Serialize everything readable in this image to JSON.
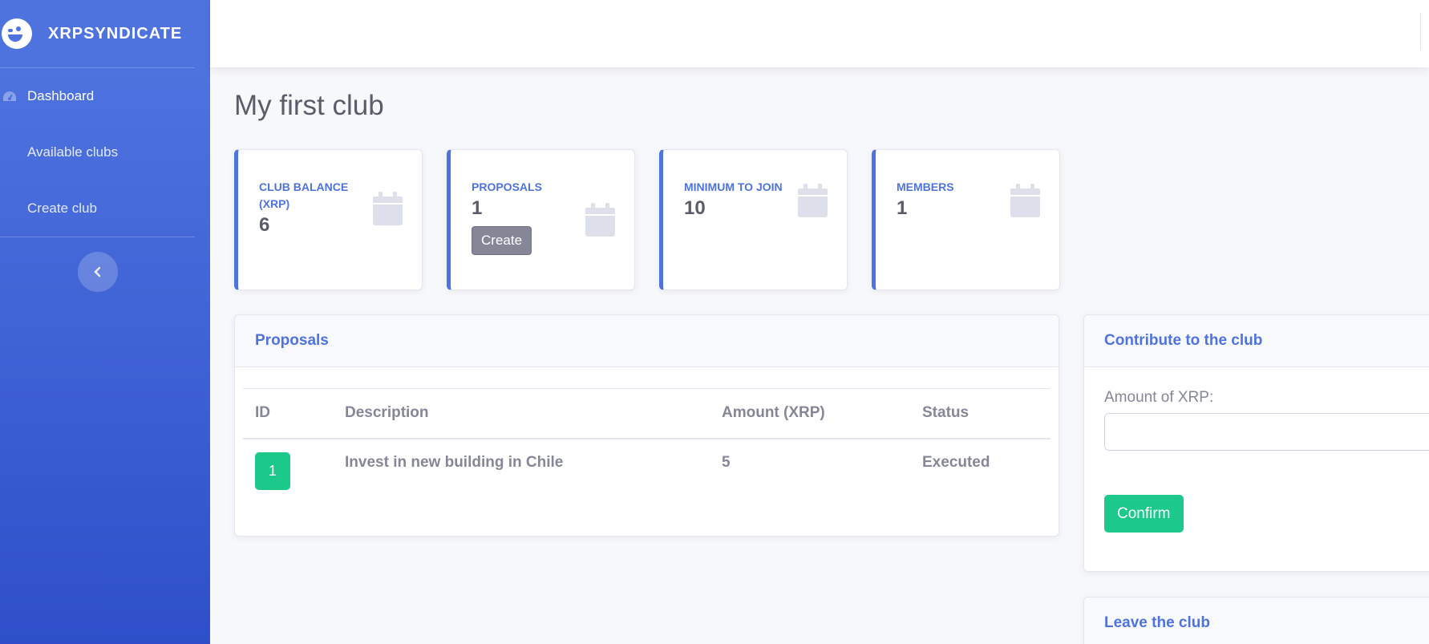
{
  "sidebar": {
    "brand": "XRPSYNDICATE",
    "items": [
      {
        "label": "Dashboard"
      },
      {
        "label": "Available clubs"
      },
      {
        "label": "Create club"
      }
    ]
  },
  "page": {
    "title": "My first club"
  },
  "stats": [
    {
      "label": "CLUB BALANCE (XRP)",
      "value": "6"
    },
    {
      "label": "PROPOSALS",
      "value": "1",
      "button": "Create"
    },
    {
      "label": "MINIMUM TO JOIN",
      "value": "10"
    },
    {
      "label": "MEMBERS",
      "value": "1"
    }
  ],
  "proposals": {
    "title": "Proposals",
    "columns": [
      "ID",
      "Description",
      "Amount (XRP)",
      "Status"
    ],
    "rows": [
      {
        "id": "1",
        "description": "Invest in new building in Chile",
        "amount": "5",
        "status": "Executed"
      }
    ]
  },
  "contribute": {
    "title": "Contribute to the club",
    "amount_label": "Amount of XRP:",
    "amount_value": "",
    "confirm_label": "Confirm"
  },
  "leave": {
    "title": "Leave the club"
  },
  "colors": {
    "primary": "#4e73df",
    "success": "#1cc88a",
    "secondary": "#858796"
  },
  "icons": {
    "stat": "calendar-icon",
    "dashboard": "tachometer-icon",
    "toggle": "chevron-left-icon",
    "logo": "wink-face-icon"
  }
}
